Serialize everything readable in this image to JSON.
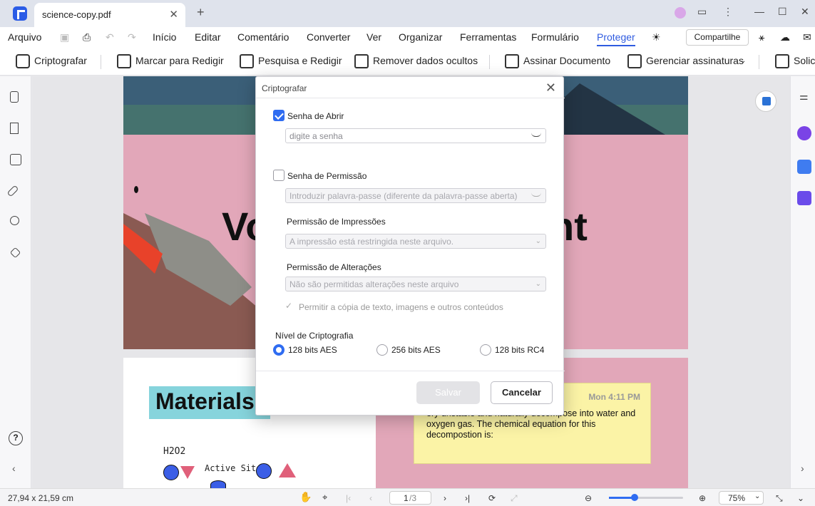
{
  "window": {
    "file_tab": "science-copy.pdf"
  },
  "menu": [
    "Arquivo",
    "Início",
    "Editar",
    "Comentário",
    "Converter",
    "Ver",
    "Organizar",
    "Ferramentas",
    "Formulário",
    "Proteger"
  ],
  "share": "Compartilhe",
  "ribbon": [
    "Criptografar",
    "Marcar para Redigir",
    "Pesquisa e Redigir",
    "Remover dados ocultos",
    "Assinar Documento",
    "Gerenciar assinaturas",
    "Solic"
  ],
  "document": {
    "heading": "Materials",
    "sticky_time": "Mon 4:11 PM",
    "sticky_text": "ery unstable and naturally decompose into water and oxygen gas. The chemical equation for this decompostion is:",
    "big_text_left": "Vo",
    "big_text_right": "nt",
    "h2o2": "H2O2",
    "active_site": "Active Site"
  },
  "dialog": {
    "title": "Criptografar",
    "open_pw_label": "Senha de Abrir",
    "open_pw_placeholder": "digite a senha",
    "perm_pw_label": "Senha de Permissão",
    "perm_pw_placeholder": "Introduzir palavra-passe (diferente da palavra-passe aberta)",
    "print_perm_label": "Permissão de Impressões",
    "print_perm_value": "A impressão está restringida neste arquivo.",
    "change_perm_label": "Permissão de Alterações",
    "change_perm_value": "Não são permitidas alterações neste arquivo",
    "copy_allow": "Permitir a cópia de texto, imagens e outros conteúdos",
    "level_label": "Nível de Criptografia",
    "levels": [
      "128 bits AES",
      "256 bits AES",
      "128 bits RC4"
    ],
    "save": "Salvar",
    "cancel": "Cancelar"
  },
  "status": {
    "size": "27,94 x 21,59 cm",
    "page": "1",
    "pages": "/3",
    "zoom": "75%"
  }
}
